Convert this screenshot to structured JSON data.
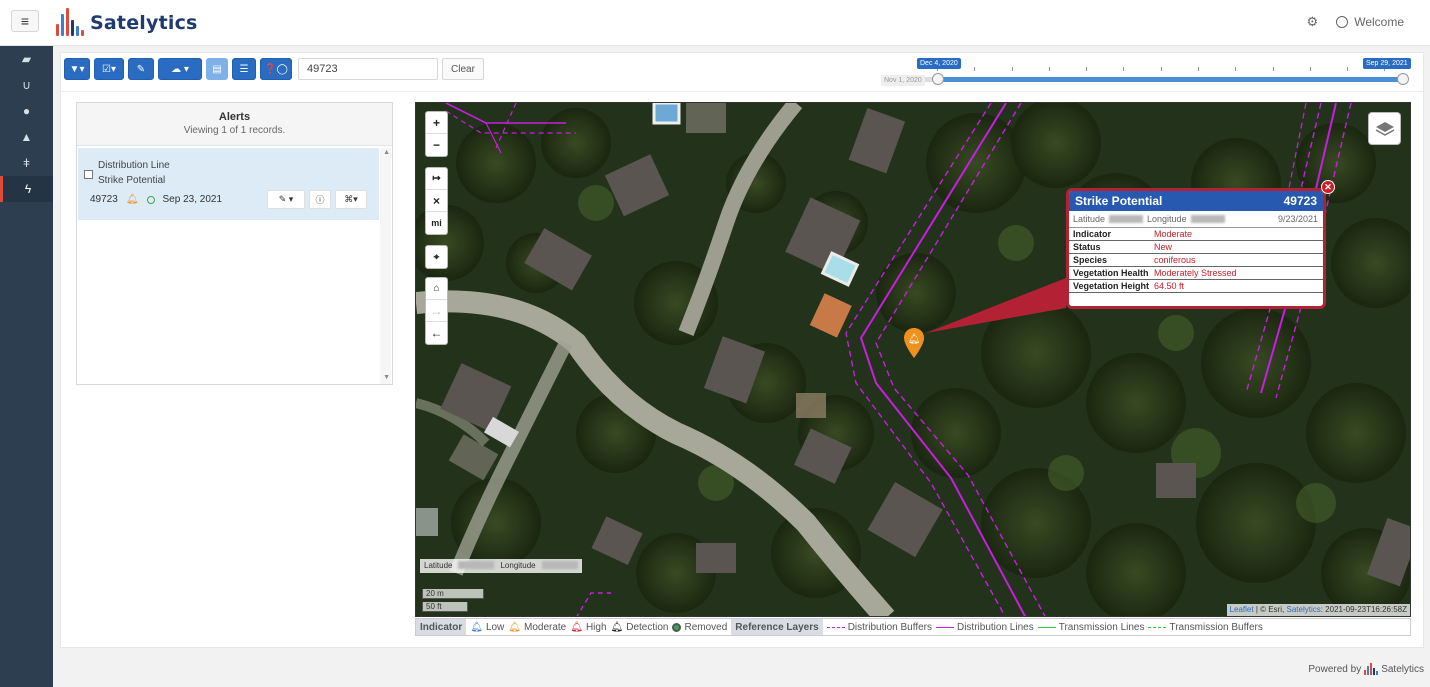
{
  "app": {
    "brand": "Satelytics",
    "welcome_label": "Welcome"
  },
  "toolbar": {
    "search_value": "49723",
    "clear_label": "Clear"
  },
  "timeline": {
    "start_label": "Dec 4, 2020",
    "end_label": "Sep 29, 2021",
    "min_label": "Nov 1, 2020"
  },
  "alerts": {
    "title": "Alerts",
    "subtitle": "Viewing 1 of 1 records.",
    "items": [
      {
        "type": "Distribution Line",
        "category": "Strike Potential",
        "id": "49723",
        "date": "Sep 23, 2021"
      }
    ]
  },
  "map": {
    "controls": {
      "zoom_in": "+",
      "zoom_out": "−",
      "measure": "↦",
      "clear": "×",
      "units": "mi"
    },
    "latitude_label": "Latitude",
    "longitude_label": "Longitude",
    "scale_m": "20 m",
    "scale_ft": "50 ft",
    "attribution": {
      "leaflet": "Leaflet",
      "esri": "© Esri,",
      "satelytics": "Satelytics",
      "timestamp": ": 2021-09-23T16:26:58Z"
    }
  },
  "popup": {
    "title": "Strike Potential",
    "id": "49723",
    "latitude_label": "Latitude",
    "longitude_label": "Longitude",
    "date": "9/23/2021",
    "rows": [
      {
        "key": "Indicator",
        "value": "Moderate"
      },
      {
        "key": "Status",
        "value": "New"
      },
      {
        "key": "Species",
        "value": "coniferous"
      },
      {
        "key": "Vegetation Health",
        "value": "Moderately Stressed"
      },
      {
        "key": "Vegetation Height",
        "value": "64.50 ft"
      }
    ]
  },
  "legend": {
    "indicator_label": "Indicator",
    "low": "Low",
    "moderate": "Moderate",
    "high": "High",
    "detection": "Detection",
    "removed": "Removed",
    "reference_label": "Reference Layers",
    "distribution_buffers": "Distribution Buffers",
    "distribution_lines": "Distribution Lines",
    "transmission_lines": "Transmission Lines",
    "transmission_buffers": "Transmission Buffers"
  },
  "footer": {
    "powered_by": "Powered by",
    "brand": "Satelytics"
  },
  "colors": {
    "primary": "#2a6cc1",
    "sidebar": "#2c3e50",
    "popup_border": "#b22234",
    "popup_header": "#2859b0",
    "distribution": "#c81ee0",
    "transmission": "#2ecc40",
    "moderate": "#f0901e"
  }
}
